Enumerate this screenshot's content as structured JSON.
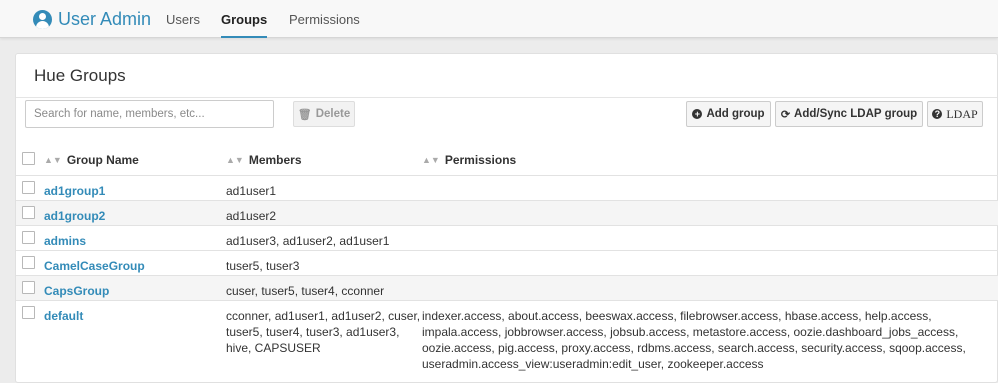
{
  "app": {
    "title": "User Admin",
    "icon": "user-circle-icon"
  },
  "nav": [
    {
      "label": "Users",
      "active": false
    },
    {
      "label": "Groups",
      "active": true
    },
    {
      "label": "Permissions",
      "active": false
    }
  ],
  "page": {
    "title": "Hue Groups"
  },
  "search": {
    "placeholder": "Search for name, members, etc...",
    "value": ""
  },
  "toolbar": {
    "delete_label": "Delete",
    "add_group_label": "Add group",
    "sync_ldap_label": "Add/Sync LDAP group",
    "ldap_label": "LDAP"
  },
  "table": {
    "columns": [
      "Group Name",
      "Members",
      "Permissions"
    ],
    "rows": [
      {
        "name": "ad1group1",
        "members": "ad1user1",
        "permissions": ""
      },
      {
        "name": "ad1group2",
        "members": "ad1user2",
        "permissions": ""
      },
      {
        "name": "admins",
        "members": "ad1user3, ad1user2, ad1user1",
        "permissions": ""
      },
      {
        "name": "CamelCaseGroup",
        "members": "tuser5, tuser3",
        "permissions": ""
      },
      {
        "name": "CapsGroup",
        "members": "cuser, tuser5, tuser4, cconner",
        "permissions": ""
      },
      {
        "name": "default",
        "members": "cconner, ad1user1, ad1user2, cuser, tuser5, tuser4, tuser3, ad1user3, hive, CAPSUSER",
        "permissions": "indexer.access, about.access, beeswax.access, filebrowser.access, hbase.access, help.access, impala.access, jobbrowser.access, jobsub.access, metastore.access, oozie.dashboard_jobs_access, oozie.access, pig.access, proxy.access, rdbms.access, search.access, security.access, sqoop.access, useradmin.access_view:useradmin:edit_user, zookeeper.access"
      }
    ]
  },
  "colors": {
    "accent": "#338bb8",
    "row_alt": "#f5f5f5"
  }
}
